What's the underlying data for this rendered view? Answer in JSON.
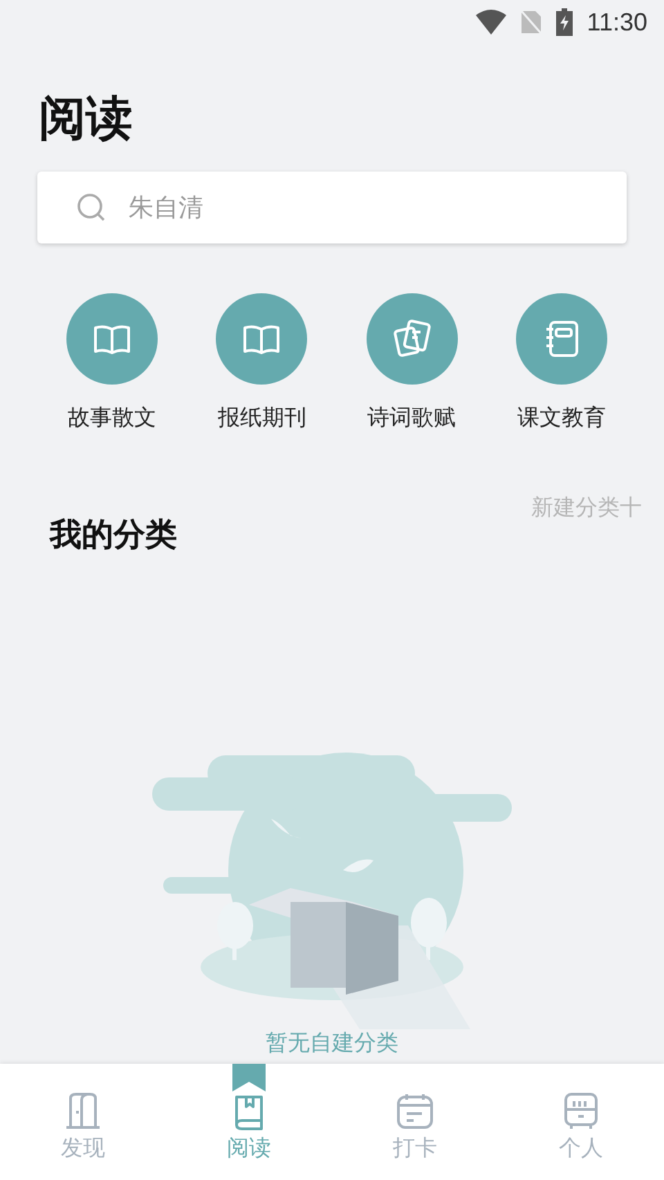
{
  "status_bar": {
    "time": "11:30"
  },
  "title": "阅读",
  "search": {
    "placeholder": "朱自清"
  },
  "categories": [
    {
      "label": "故事散文",
      "kind": "book"
    },
    {
      "label": "报纸期刊",
      "kind": "book"
    },
    {
      "label": "诗词歌赋",
      "kind": "papers"
    },
    {
      "label": "课文教育",
      "kind": "notebook"
    }
  ],
  "my_categories": {
    "title": "我的分类",
    "action": "新建分类十"
  },
  "empty_state": {
    "message": "暂无自建分类"
  },
  "tabs": [
    {
      "label": "发现",
      "kind": "door",
      "selected": false
    },
    {
      "label": "阅读",
      "kind": "book",
      "selected": true
    },
    {
      "label": "打卡",
      "kind": "calendar",
      "selected": false
    },
    {
      "label": "个人",
      "kind": "cabinet",
      "selected": false
    }
  ]
}
